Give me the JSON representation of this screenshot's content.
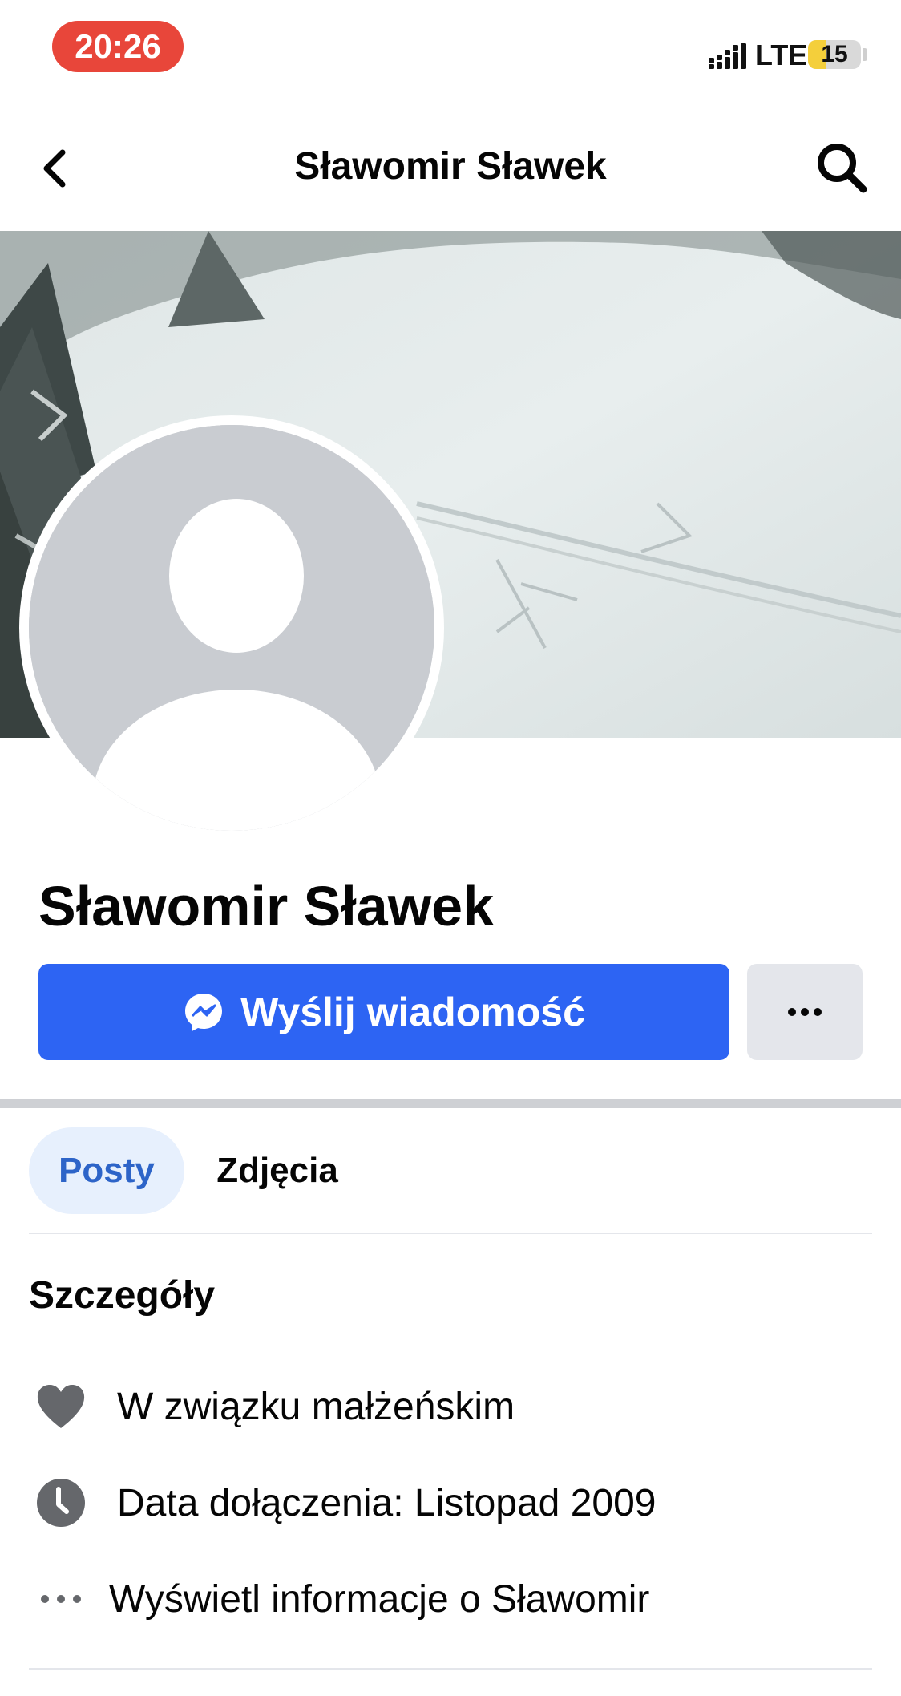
{
  "status_bar": {
    "time": "20:26",
    "network": "LTE",
    "battery_level": "15",
    "battery_fill_fraction": 0.15,
    "battery_color": "#f4cf3b",
    "time_pill_color": "#e8463a"
  },
  "nav": {
    "title": "Sławomir Sławek",
    "back_icon": "chevron-left-icon",
    "search_icon": "search-icon"
  },
  "profile": {
    "name": "Sławomir Sławek",
    "cover_description_icon": "cover-photo",
    "avatar_icon": "default-avatar-icon"
  },
  "actions": {
    "message_label": "Wyślij wiadomość",
    "message_icon": "messenger-icon",
    "more_icon": "more-horizontal-icon",
    "accent_color": "#2d64f3"
  },
  "tabs": [
    {
      "label": "Posty",
      "active": true
    },
    {
      "label": "Zdjęcia",
      "active": false
    }
  ],
  "details": {
    "heading": "Szczegóły",
    "items": [
      {
        "icon": "heart-icon",
        "text": "W związku małżeńskim"
      },
      {
        "icon": "clock-icon",
        "text": "Data dołączenia: Listopad 2009"
      },
      {
        "icon": "more-horizontal-icon",
        "text": "Wyświetl informacje o Sławomir"
      }
    ]
  }
}
